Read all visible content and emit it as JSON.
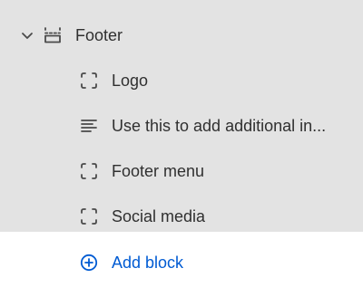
{
  "section": {
    "label": "Footer",
    "icon": "footer-section-icon",
    "expanded": true
  },
  "blocks": [
    {
      "label": "Logo",
      "icon": "block-frame-icon"
    },
    {
      "label": "Use this to add additional in...",
      "icon": "text-block-icon"
    },
    {
      "label": "Footer menu",
      "icon": "block-frame-icon"
    },
    {
      "label": "Social media",
      "icon": "block-frame-icon"
    }
  ],
  "add_block": {
    "label": "Add block",
    "icon": "plus-circle-icon"
  },
  "colors": {
    "panel_background": "#e3e3e3",
    "add_area_background": "#ffffff",
    "text": "#303030",
    "accent": "#005bd3"
  }
}
